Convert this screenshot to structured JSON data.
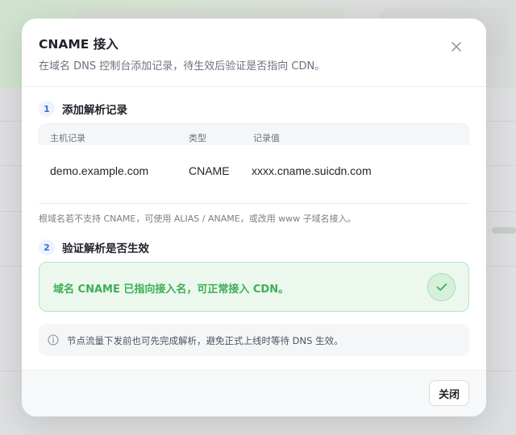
{
  "dialog": {
    "title": "CNAME 接入",
    "subtitle": "在域名 DNS 控制台添加记录，待生效后验证是否指向 CDN。"
  },
  "step1": {
    "number": "1",
    "label": "添加解析记录"
  },
  "record_table": {
    "columns": [
      "主机记录",
      "类型",
      "记录值"
    ],
    "rows": [
      [
        "demo.example.com",
        "CNAME",
        "xxxx.cname.suicdn.com"
      ]
    ]
  },
  "hint": "根域名若不支持 CNAME，可使用 ALIAS / ANAME，或改用 www 子域名接入。",
  "step2": {
    "number": "2",
    "label": "验证解析是否生效"
  },
  "verify": {
    "message": "域名 CNAME 已指向接入名，可正常接入 CDN。",
    "status_icon": "check-icon"
  },
  "tip": {
    "icon": "info-icon",
    "text": "节点流量下发前也可先完成解析，避免正式上线时等待 DNS 生效。"
  },
  "footer": {
    "close_label": "关闭"
  },
  "colors": {
    "success_text": "#3dae55",
    "success_bg": "#ecf8ee",
    "step_accent": "#3b6fd6"
  }
}
